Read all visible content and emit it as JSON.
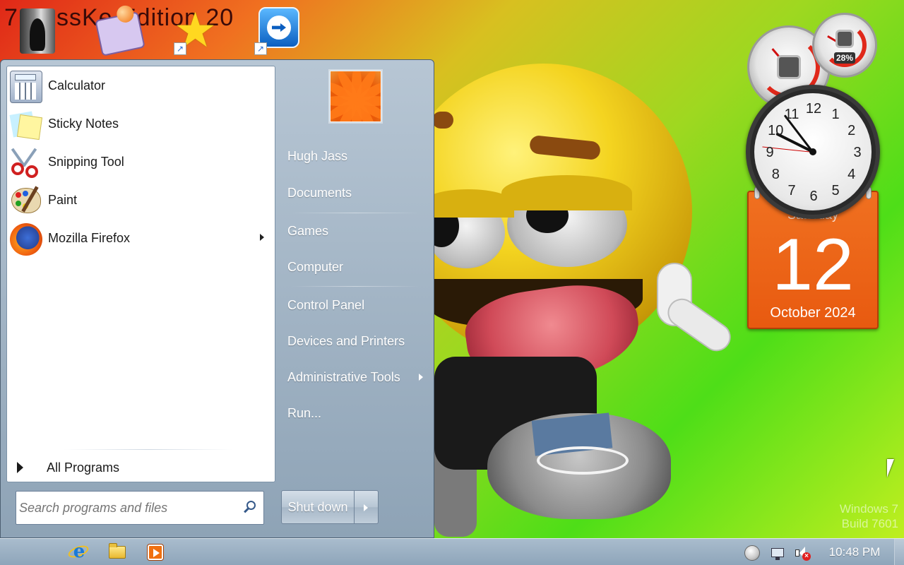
{
  "desktop": {
    "wallpaper_title": "7 BossKe Edition 20",
    "watermark_line1": "Windows 7",
    "watermark_line2": "Build 7601",
    "icons": [
      {
        "name": "book-reader-icon"
      },
      {
        "name": "paint-program-icon"
      },
      {
        "name": "favorites-star-icon"
      },
      {
        "name": "teamviewer-icon"
      }
    ]
  },
  "gadgets": {
    "cpu_meter": {
      "ram_percent_label": "28%",
      "cpu_level": 0.35,
      "ram_level": 0.28
    },
    "clock": {
      "hour": 9,
      "minute": 53,
      "second": 46
    },
    "calendar": {
      "day_of_week": "Saturday",
      "date": "12",
      "month_year": "October 2024",
      "accent": "#f07020"
    }
  },
  "start_menu": {
    "pinned_programs": [
      {
        "label": "Calculator",
        "icon": "calculator-icon",
        "has_submenu": false
      },
      {
        "label": "Sticky Notes",
        "icon": "sticky-notes-icon",
        "has_submenu": false
      },
      {
        "label": "Snipping Tool",
        "icon": "snipping-tool-icon",
        "has_submenu": false
      },
      {
        "label": "Paint",
        "icon": "paint-icon",
        "has_submenu": false
      },
      {
        "label": "Mozilla Firefox",
        "icon": "firefox-icon",
        "has_submenu": true
      }
    ],
    "all_programs_label": "All Programs",
    "search_placeholder": "Search programs and files",
    "user_name": "Hugh Jass",
    "right_items": {
      "documents": "Documents",
      "games": "Games",
      "computer": "Computer",
      "control_panel": "Control Panel",
      "devices_printers": "Devices and Printers",
      "admin_tools": "Administrative Tools",
      "run": "Run..."
    },
    "shutdown_label": "Shut down"
  },
  "taskbar": {
    "pinned": [
      "internet-explorer-icon",
      "windows-explorer-icon",
      "media-player-icon"
    ],
    "time": "10:48 PM",
    "colors": {
      "bar": "#9bb0c3"
    }
  }
}
